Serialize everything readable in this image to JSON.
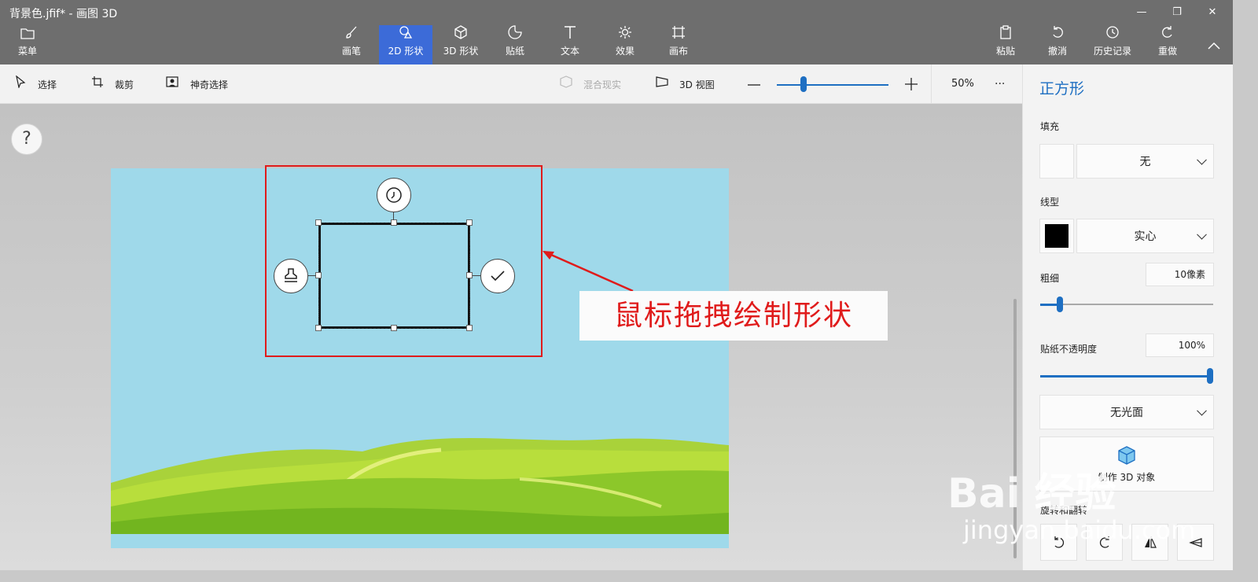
{
  "window": {
    "title": "背景色.jfif* - 画图 3D",
    "minimize": "—",
    "maximize": "❐",
    "close": "✕"
  },
  "menu": {
    "label": "菜单",
    "icon": "folder-icon"
  },
  "tools": [
    {
      "label": "画笔",
      "icon": "brush-icon",
      "active": false
    },
    {
      "label": "2D 形状",
      "icon": "2d-shapes-icon",
      "active": true
    },
    {
      "label": "3D 形状",
      "icon": "3d-shapes-icon",
      "active": false
    },
    {
      "label": "贴纸",
      "icon": "sticker-icon",
      "active": false
    },
    {
      "label": "文本",
      "icon": "text-icon",
      "active": false
    },
    {
      "label": "效果",
      "icon": "effects-icon",
      "active": false
    },
    {
      "label": "画布",
      "icon": "canvas-icon",
      "active": false
    }
  ],
  "right_tools": [
    {
      "label": "粘贴",
      "icon": "paste-icon"
    },
    {
      "label": "撤消",
      "icon": "undo-icon"
    },
    {
      "label": "历史记录",
      "icon": "history-icon"
    },
    {
      "label": "重做",
      "icon": "redo-icon"
    }
  ],
  "toolbar2": {
    "select": "选择",
    "crop": "裁剪",
    "magic_select": "神奇选择",
    "mixed_reality": "混合现实",
    "view_3d": "3D 视图",
    "zoom_value": "50%",
    "zoom_level": 0.24,
    "more": "···"
  },
  "help": "?",
  "panel": {
    "title": "正方形",
    "fill_label": "填充",
    "fill_value": "无",
    "line_label": "线型",
    "line_value": "实心",
    "line_color": "#000000",
    "thickness_label": "粗细",
    "thickness_value": "10像素",
    "thickness_level": 0.1,
    "opacity_label": "贴纸不透明度",
    "opacity_value": "100%",
    "opacity_level": 1.0,
    "finish_value": "无光面",
    "make3d_label": "制作 3D 对象",
    "rotate_label": "旋转和翻转",
    "accent": "#1e6fc2"
  },
  "annotation": {
    "text": "鼠标拖拽绘制形状",
    "color": "#e01b1b"
  },
  "watermark": {
    "line1": "Bai 经验",
    "line2": "jingyan.baidu.com"
  },
  "colors": {
    "sky": "#9fd9ea",
    "active_tool": "#3c6bd8"
  }
}
